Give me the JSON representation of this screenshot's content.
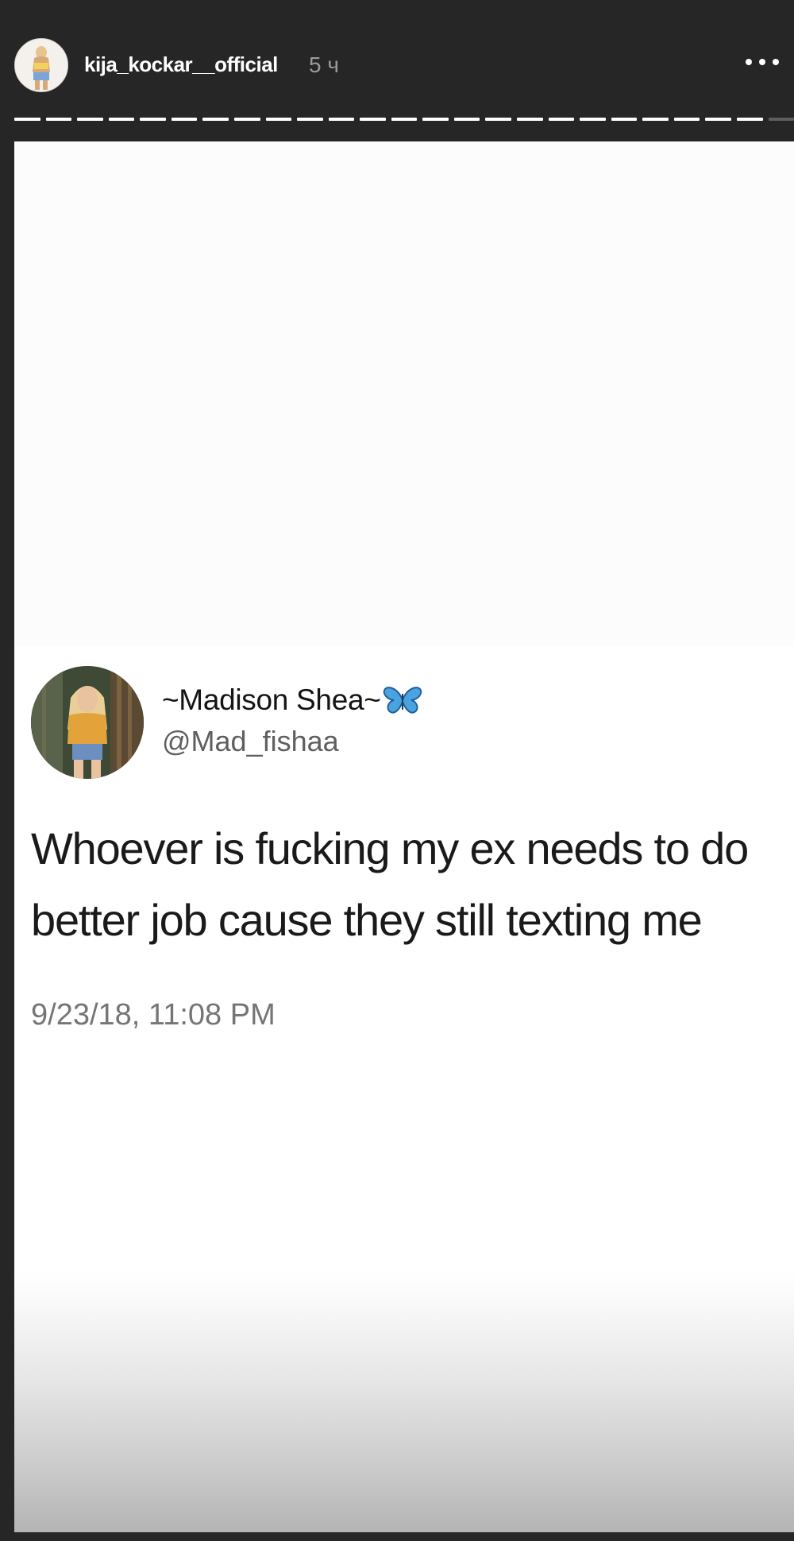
{
  "story": {
    "username": "kija_kockar__official",
    "time_ago": "5 ч",
    "more_icon": "more-horizontal-icon",
    "segments_total": 25,
    "segments_seen": 24
  },
  "tweet": {
    "display_name": "~Madison Shea~",
    "badge_icon": "butterfly-emoji-icon",
    "handle": "@Mad_fishaa",
    "text_line_1": "Whoever is fucking my ex needs to do",
    "text_line_2": "better job cause they still texting me",
    "timestamp": "9/23/18, 11:08 PM"
  },
  "colors": {
    "background": "#262626",
    "header_text": "#ffffff",
    "time_ago": "#9a9a9a",
    "tweet_text": "#1a1a1a",
    "handle": "#5f5f5f",
    "timestamp": "#757575",
    "butterfly": "#4aa3e0"
  }
}
